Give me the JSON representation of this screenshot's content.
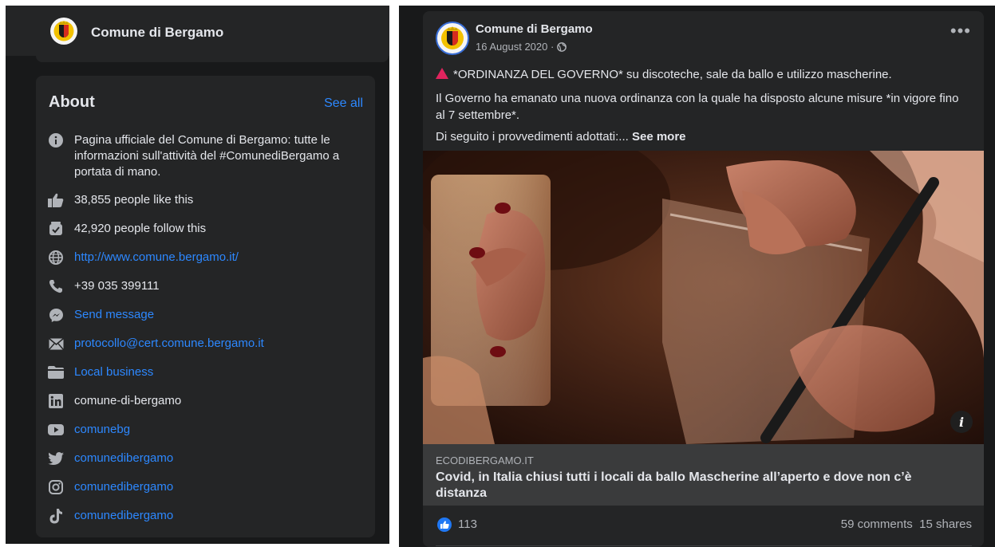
{
  "left": {
    "header": {
      "page_name": "Comune di Bergamo"
    },
    "about": {
      "title": "About",
      "see_all": "See all",
      "items": [
        {
          "icon": "info-icon",
          "text": "Pagina ufficiale del Comune di Bergamo: tutte le informazioni sull'attività del #ComunediBergamo a portata di mano.",
          "link": false
        },
        {
          "icon": "thumbs-up-icon",
          "text": "38,855 people like this",
          "link": false
        },
        {
          "icon": "follow-icon",
          "text": "42,920 people follow this",
          "link": false
        },
        {
          "icon": "globe-icon",
          "text": "http://www.comune.bergamo.it/",
          "link": true
        },
        {
          "icon": "phone-icon",
          "text": "+39 035 399111",
          "link": false
        },
        {
          "icon": "messenger-icon",
          "text": "Send message",
          "link": true
        },
        {
          "icon": "envelope-icon",
          "text": "protocollo@cert.comune.bergamo.it",
          "link": true
        },
        {
          "icon": "folder-icon",
          "text": "Local business",
          "link": true
        },
        {
          "icon": "linkedin-icon",
          "text": "comune-di-bergamo",
          "link": false
        },
        {
          "icon": "youtube-icon",
          "text": "comunebg",
          "link": true
        },
        {
          "icon": "twitter-icon",
          "text": "comunedibergamo",
          "link": true
        },
        {
          "icon": "instagram-icon",
          "text": "comunedibergamo",
          "link": true
        },
        {
          "icon": "tiktok-icon",
          "text": "comunedibergamo",
          "link": true
        }
      ]
    }
  },
  "post": {
    "author": "Comune di Bergamo",
    "date": "16 August 2020 ·",
    "line1": "*ORDINANZA DEL GOVERNO* su discoteche, sale da ballo e utilizzo mascherine.",
    "line2": "Il Governo ha emanato una nuova ordinanza con la quale ha disposto alcune misure *in vigore fino al 7 settembre*.",
    "line3": "Di seguito i provvedimenti adottati:...",
    "see_more": "See more",
    "info_label": "i",
    "link_domain": "ECODIBERGAMO.IT",
    "link_headline": "Covid, in Italia chiusi tutti i locali da ballo Mascherine all’aperto e dove non c’è distanza",
    "reactions_count": "113",
    "comments": "59 comments",
    "shares": "15 shares"
  },
  "colors": {
    "link_blue": "#2d88ff",
    "card_bg": "#242526",
    "page_bg": "#18191a",
    "warning_red": "#e0245e",
    "like_blue": "#2078f4"
  }
}
